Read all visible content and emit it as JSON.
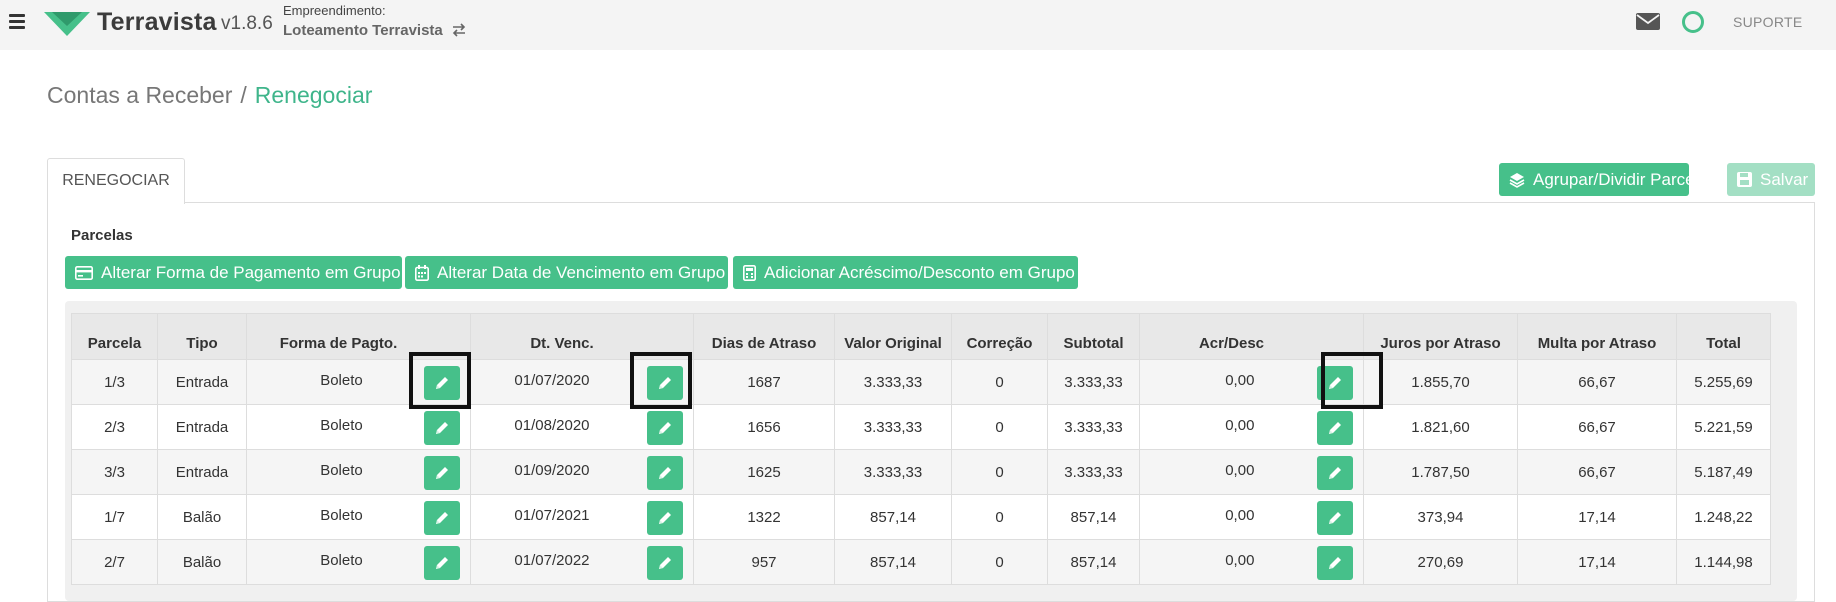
{
  "header": {
    "brand": "Terravista",
    "version": "v1.8.6",
    "empreendimento_label": "Empreendimento:",
    "empreendimento_value": "Loteamento Terravista",
    "support_label": "SUPORTE",
    "brand_color": "#46c08a"
  },
  "breadcrumb": {
    "parent": "Contas a Receber",
    "separator": "/",
    "current": "Renegociar"
  },
  "tab": {
    "label": "RENEGOCIAR"
  },
  "toolbar": {
    "agrupar_label": "Agrupar/Dividir Parcelas",
    "salvar_label": "Salvar"
  },
  "section": {
    "title": "Parcelas",
    "btn_forma": "Alterar Forma de Pagamento em Grupo",
    "btn_data": "Alterar Data de Vencimento em Grupo",
    "btn_acrescimo": "Adicionar Acréscimo/Desconto em Grupo"
  },
  "table": {
    "columns": [
      "Parcela",
      "Tipo",
      "Forma de Pagto.",
      "Dt. Venc.",
      "Dias de Atraso",
      "Valor Original",
      "Correção",
      "Subtotal",
      "Acr/Desc",
      "Juros por Atraso",
      "Multa por Atraso",
      "Total"
    ],
    "rows": [
      {
        "parcela": "1/3",
        "tipo": "Entrada",
        "forma": "Boleto",
        "venc": "01/07/2020",
        "dias": "1687",
        "original": "3.333,33",
        "correcao": "0",
        "subtotal": "3.333,33",
        "acr": "0,00",
        "juros": "1.855,70",
        "multa": "66,67",
        "total": "5.255,69"
      },
      {
        "parcela": "2/3",
        "tipo": "Entrada",
        "forma": "Boleto",
        "venc": "01/08/2020",
        "dias": "1656",
        "original": "3.333,33",
        "correcao": "0",
        "subtotal": "3.333,33",
        "acr": "0,00",
        "juros": "1.821,60",
        "multa": "66,67",
        "total": "5.221,59"
      },
      {
        "parcela": "3/3",
        "tipo": "Entrada",
        "forma": "Boleto",
        "venc": "01/09/2020",
        "dias": "1625",
        "original": "3.333,33",
        "correcao": "0",
        "subtotal": "3.333,33",
        "acr": "0,00",
        "juros": "1.787,50",
        "multa": "66,67",
        "total": "5.187,49"
      },
      {
        "parcela": "1/7",
        "tipo": "Balão",
        "forma": "Boleto",
        "venc": "01/07/2021",
        "dias": "1322",
        "original": "857,14",
        "correcao": "0",
        "subtotal": "857,14",
        "acr": "0,00",
        "juros": "373,94",
        "multa": "17,14",
        "total": "1.248,22"
      },
      {
        "parcela": "2/7",
        "tipo": "Balão",
        "forma": "Boleto",
        "venc": "01/07/2022",
        "dias": "957",
        "original": "857,14",
        "correcao": "0",
        "subtotal": "857,14",
        "acr": "0,00",
        "juros": "270,69",
        "multa": "17,14",
        "total": "1.144,98"
      }
    ]
  }
}
